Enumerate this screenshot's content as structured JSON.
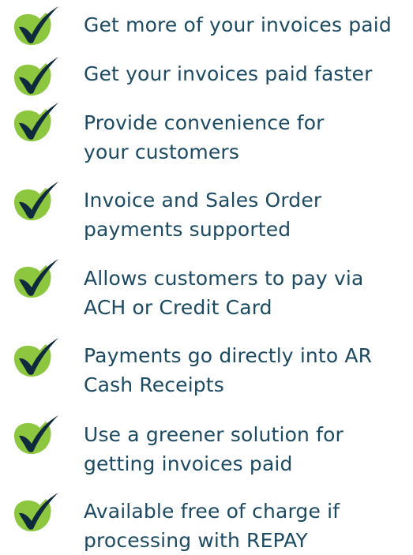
{
  "colors": {
    "text": "#1c4a63",
    "check_fill": "#8dc63f",
    "check_stroke": "#0f2a3d"
  },
  "icon": "checkmark-icon",
  "benefits": [
    {
      "lines": [
        "Get more of your invoices paid"
      ]
    },
    {
      "lines": [
        "Get your invoices paid faster"
      ]
    },
    {
      "lines": [
        "Provide convenience for",
        "your customers"
      ]
    },
    {
      "lines": [
        "Invoice and Sales Order",
        "payments supported"
      ]
    },
    {
      "lines": [
        "Allows customers to pay via",
        "ACH or Credit Card"
      ]
    },
    {
      "lines": [
        "Payments go directly into AR",
        "Cash Receipts"
      ]
    },
    {
      "lines": [
        "Use a greener solution for",
        "getting invoices paid"
      ]
    },
    {
      "lines": [
        "Available free of charge if",
        "processing with REPAY"
      ]
    }
  ]
}
